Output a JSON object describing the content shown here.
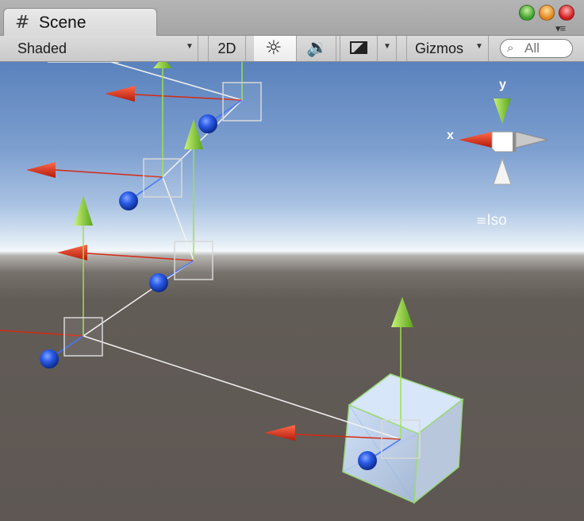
{
  "window": {
    "tab_title": "Scene",
    "tab_icon": "grid-icon",
    "tab_menu_icon": "▾≡"
  },
  "toolbar": {
    "shading_mode": "Shaded",
    "mode_2d_label": "2D",
    "lighting_icon": "☼",
    "audio_icon": "🔉",
    "gizmos_label": "Gizmos",
    "search_placeholder": "All",
    "dropdown_caret": "▼"
  },
  "scene_gizmo": {
    "x_axis_label": "x",
    "y_axis_label": "y",
    "projection_label": "Iso",
    "projection_icon": "≡"
  },
  "colors": {
    "x_axis": "#e8341c",
    "y_axis": "#8fd12c",
    "z_axis": "#2a55e0",
    "sky_top": "#5a82bd",
    "ground": "#5e5753"
  }
}
